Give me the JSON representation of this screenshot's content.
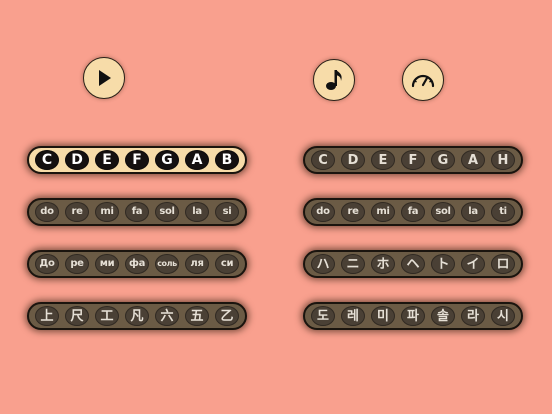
{
  "controls": {
    "play_icon": "play-icon",
    "music_icon": "music-note-icon",
    "speed_icon": "speedometer-icon"
  },
  "colors": {
    "background": "#f9a08e",
    "button_fill": "#f7dca9",
    "pill_fill": "#6b5b45",
    "selected_pill_fill": "#f7dca9",
    "note_fill": "#4a4035",
    "selected_note_fill": "#141010"
  },
  "left_sets": [
    {
      "name": "letters",
      "selected": true,
      "notes": [
        "C",
        "D",
        "E",
        "F",
        "G",
        "A",
        "B"
      ]
    },
    {
      "name": "solfege",
      "selected": false,
      "notes": [
        "do",
        "re",
        "mi",
        "fa",
        "sol",
        "la",
        "si"
      ]
    },
    {
      "name": "russian",
      "selected": false,
      "notes": [
        "До",
        "ре",
        "ми",
        "фа",
        "соль",
        "ля",
        "си"
      ]
    },
    {
      "name": "gongche",
      "selected": false,
      "notes": [
        "上",
        "尺",
        "工",
        "凡",
        "六",
        "五",
        "乙"
      ]
    }
  ],
  "right_sets": [
    {
      "name": "german-letters",
      "selected": false,
      "notes": [
        "C",
        "D",
        "E",
        "F",
        "G",
        "A",
        "H"
      ]
    },
    {
      "name": "movable-do",
      "selected": false,
      "notes": [
        "do",
        "re",
        "mi",
        "fa",
        "sol",
        "la",
        "ti"
      ]
    },
    {
      "name": "japanese",
      "selected": false,
      "notes": [
        "ハ",
        "ニ",
        "ホ",
        "ヘ",
        "ト",
        "イ",
        "ロ"
      ]
    },
    {
      "name": "korean",
      "selected": false,
      "notes": [
        "도",
        "레",
        "미",
        "파",
        "솔",
        "라",
        "시"
      ]
    }
  ]
}
